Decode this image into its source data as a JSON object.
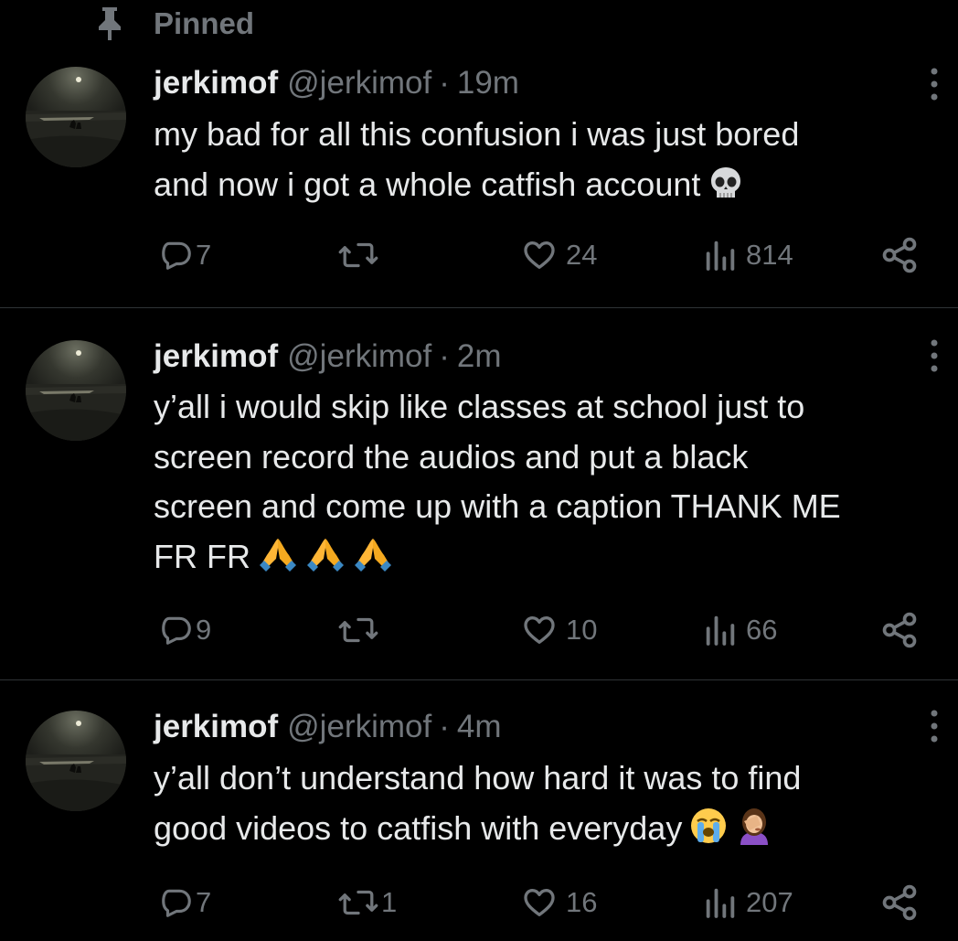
{
  "pinned": {
    "label": "Pinned"
  },
  "tweets": [
    {
      "display_name": "jerkimof",
      "handle": "@jerkimof",
      "separator": "·",
      "time": "19m",
      "text": "my bad for all this confusion i was just bored\nand now i got a whole catfish account",
      "emojis": [
        "skull-emoji"
      ],
      "replies": "7",
      "reposts": "",
      "likes": "24",
      "views": "814"
    },
    {
      "display_name": "jerkimof",
      "handle": "@jerkimof",
      "separator": "·",
      "time": "2m",
      "text": "y’all i would skip like classes at school just to\nscreen record the audios and put a black\nscreen and come up with a caption THANK ME\nFR FR",
      "emojis": [
        "folded-hands-emoji",
        "folded-hands-emoji",
        "folded-hands-emoji"
      ],
      "replies": "9",
      "reposts": "",
      "likes": "10",
      "views": "66"
    },
    {
      "display_name": "jerkimof",
      "handle": "@jerkimof",
      "separator": "·",
      "time": "4m",
      "text": "y’all don’t understand how hard it was to find\ngood videos to catfish with everyday",
      "emojis": [
        "loudly-crying-face-emoji",
        "woman-facepalming-emoji"
      ],
      "replies": "7",
      "reposts": "1",
      "likes": "16",
      "views": "207"
    }
  ],
  "colors": {
    "background": "#000000",
    "text_primary": "#e7e9ea",
    "text_secondary": "#71767b",
    "divider": "#2f3336"
  }
}
